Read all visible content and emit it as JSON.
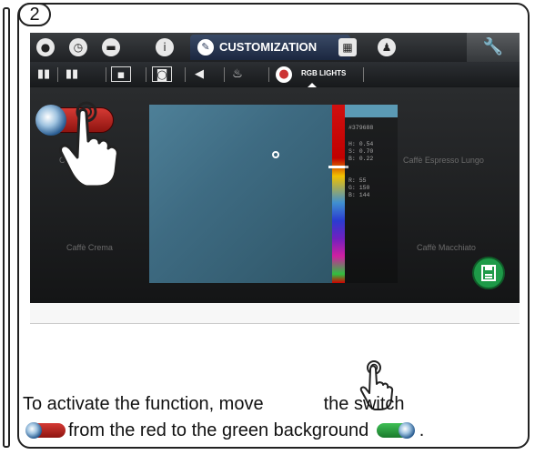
{
  "step_number": "2",
  "toolbar": {
    "tabs": [
      {
        "icon": "water-drop-icon",
        "active": false
      },
      {
        "icon": "clock-icon",
        "active": false
      },
      {
        "icon": "cup-icon",
        "active": false
      },
      {
        "icon": "info-icon",
        "active": false
      },
      {
        "icon": "pencil-icon",
        "label": "CUSTOMIZATION",
        "active": true
      },
      {
        "icon": "calculator-icon",
        "active": false
      },
      {
        "icon": "counter-icon",
        "active": false
      }
    ],
    "settings_icon": "wrench-icon"
  },
  "subtoolbar": {
    "items": [
      {
        "icon": "book-icon"
      },
      {
        "icon": "book-person-icon"
      },
      {
        "icon": "picture-icon"
      },
      {
        "icon": "screensaver-icon"
      },
      {
        "icon": "speaker-icon"
      },
      {
        "icon": "cup-steam-icon"
      },
      {
        "icon": "palette-icon",
        "label": "RGB LIGHTS",
        "active": true
      }
    ]
  },
  "background_labels": {
    "top_left": "Caffè",
    "top_right": "Caffè Espresso Lungo",
    "bottom_left": "Caffè Crema",
    "bottom_right": "Caffè Macchiato"
  },
  "color_picker": {
    "hex": "#379688",
    "hsb": {
      "h": "H: 0.54",
      "s": "S: 0.70",
      "b": "B: 0.22"
    },
    "rgb": {
      "r": "R: 55",
      "g": "G: 150",
      "b": "B: 144"
    },
    "swatch_color": "#5b9ab5"
  },
  "toggle_state": "off",
  "toggle_off_color": "#c0302a",
  "toggle_on_color": "#2e9e44",
  "save_icon": "save-icon",
  "instruction": {
    "line1_a": "To activate the function, move",
    "line1_b": "the switch",
    "line2_a": "from the red to the green background",
    "line2_end": "."
  }
}
